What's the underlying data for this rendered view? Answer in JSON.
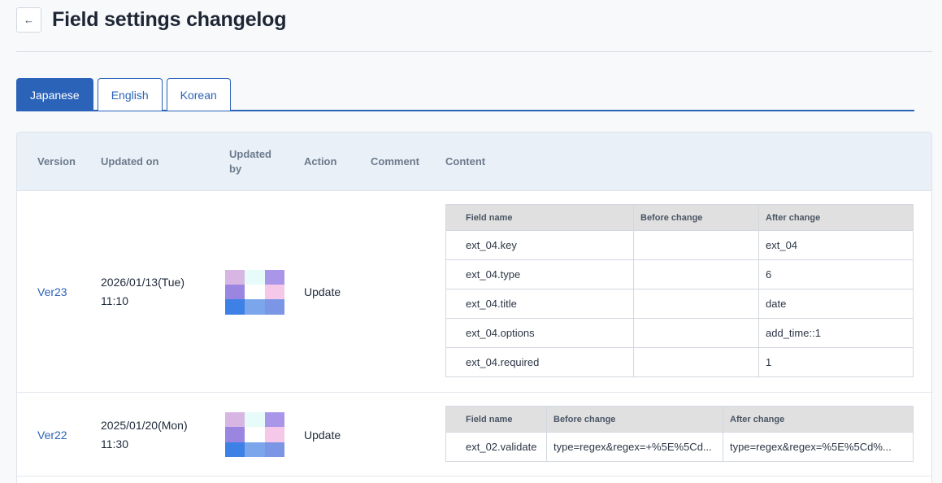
{
  "page": {
    "title": "Field settings changelog",
    "back_glyph": "←"
  },
  "tabs": [
    {
      "label": "Japanese",
      "active": true
    },
    {
      "label": "English",
      "active": false
    },
    {
      "label": "Korean",
      "active": false
    }
  ],
  "columns": {
    "version": "Version",
    "updated_on": "Updated on",
    "updated_by_line1": "Updated",
    "updated_by_line2": "by",
    "action": "Action",
    "comment": "Comment",
    "content": "Content"
  },
  "rows": [
    {
      "version": "Ver23",
      "date": "2026/01/13(Tue)",
      "time": "11:10",
      "avatar_colors": [
        "#d8b6e4",
        "#e8fbfb",
        "#a996e8",
        "#9a86e0",
        "#ffffff",
        "#f5c8ea",
        "#3d80e6",
        "#7ca6ec",
        "#7a96e4"
      ],
      "action": "Update",
      "comment": "",
      "content": {
        "headers": [
          "Field name",
          "Before change",
          "After change"
        ],
        "rows": [
          [
            "ext_04.key",
            "",
            "ext_04"
          ],
          [
            "ext_04.type",
            "",
            "6"
          ],
          [
            "ext_04.title",
            "",
            "date"
          ],
          [
            "ext_04.options",
            "",
            "add_time::1"
          ],
          [
            "ext_04.required",
            "",
            "1"
          ]
        ]
      }
    },
    {
      "version": "Ver22",
      "date": "2025/01/20(Mon)",
      "time": "11:30",
      "avatar_colors": [
        "#d8b6e4",
        "#e8fbfb",
        "#a996e8",
        "#9a86e0",
        "#ffffff",
        "#f5c8ea",
        "#3d80e6",
        "#7ca6ec",
        "#7a96e4"
      ],
      "action": "Update",
      "comment": "",
      "content": {
        "headers": [
          "Field name",
          "Before change",
          "After change"
        ],
        "rows": [
          [
            "ext_02.validate",
            "type=regex&regex=+%5E%5Cd...",
            "type=regex&regex=%5E%5Cd%..."
          ]
        ]
      }
    }
  ]
}
